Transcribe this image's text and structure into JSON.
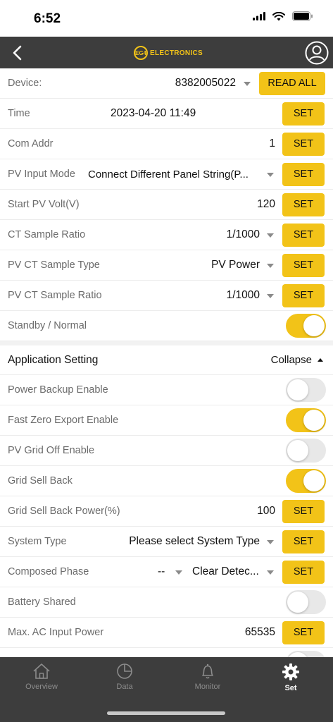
{
  "status_bar": {
    "time": "6:52"
  },
  "header": {
    "logo_badge": "EG4",
    "logo_text": "ELECTRONICS"
  },
  "device": {
    "label": "Device:",
    "value": "8382005022",
    "read_all_label": "READ ALL"
  },
  "settings": [
    {
      "label": "Time",
      "value": "2023-04-20 11:49",
      "control": "set"
    },
    {
      "label": "Com Addr",
      "value": "1",
      "control": "set"
    },
    {
      "label": "PV Input Mode",
      "value": "Connect Different Panel String(P...",
      "control": "select-set"
    },
    {
      "label": "Start PV Volt(V)",
      "value": "120",
      "control": "set"
    },
    {
      "label": "CT Sample Ratio",
      "value": "1/1000",
      "control": "select-set"
    },
    {
      "label": "PV CT Sample Type",
      "value": "PV Power",
      "control": "select-set"
    },
    {
      "label": "PV CT Sample Ratio",
      "value": "1/1000",
      "control": "select-set"
    },
    {
      "label": "Standby / Normal",
      "control": "toggle",
      "on": true
    }
  ],
  "application": {
    "title": "Application Setting",
    "collapse_label": "Collapse",
    "rows": [
      {
        "label": "Power Backup Enable",
        "control": "toggle",
        "on": false
      },
      {
        "label": "Fast Zero Export Enable",
        "control": "toggle",
        "on": true
      },
      {
        "label": "PV Grid Off Enable",
        "control": "toggle",
        "on": false
      },
      {
        "label": "Grid Sell Back",
        "control": "toggle",
        "on": true
      },
      {
        "label": "Grid Sell Back Power(%)",
        "value": "100",
        "control": "set"
      },
      {
        "label": "System Type",
        "value": "Please select System Type",
        "control": "select-set"
      },
      {
        "label": "Composed Phase",
        "value": "--",
        "value2": "Clear Detec...",
        "control": "dual-select-set"
      },
      {
        "label": "Battery Shared",
        "control": "toggle",
        "on": false
      },
      {
        "label": "Max. AC Input Power",
        "value": "65535",
        "control": "set"
      }
    ]
  },
  "set_label": "SET",
  "tabs": [
    {
      "label": "Overview",
      "icon": "home-icon",
      "active": false
    },
    {
      "label": "Data",
      "icon": "pie-chart-icon",
      "active": false
    },
    {
      "label": "Monitor",
      "icon": "bell-icon",
      "active": false
    },
    {
      "label": "Set",
      "icon": "gear-icon",
      "active": true
    }
  ],
  "colors": {
    "accent": "#f2c318",
    "header_bg": "#3d3d3d",
    "toggle_off": "#e8e8e8"
  }
}
